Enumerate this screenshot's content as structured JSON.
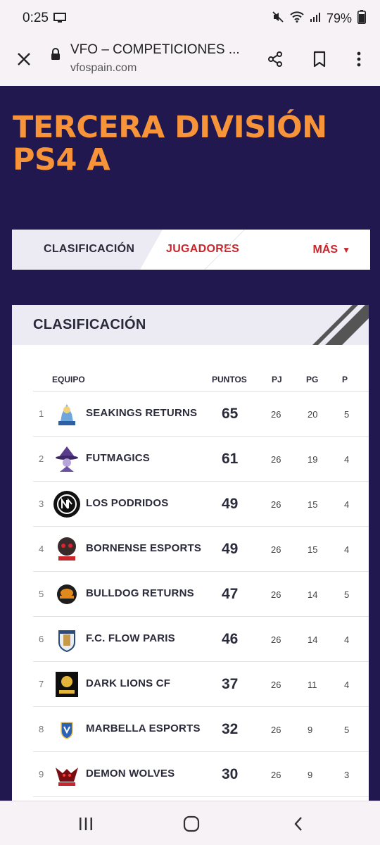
{
  "status": {
    "time": "0:25",
    "battery": "79%"
  },
  "browser": {
    "title": "VFO – COMPETICIONES ...",
    "domain": "vfospain.com"
  },
  "league": {
    "title": "TERCERA DIVISIÓN PS4 A"
  },
  "tabs": {
    "clasificacion": "CLASIFICACIÓN",
    "jugadores": "JUGADORES",
    "mas": "MÁS"
  },
  "card": {
    "title": "CLASIFICACIÓN"
  },
  "table": {
    "headers": {
      "equipo": "EQUIPO",
      "puntos": "PUNTOS",
      "pj": "PJ",
      "pg": "PG",
      "pe": "P"
    },
    "rows": [
      {
        "pos": "1",
        "team": "SEAKINGS RETURNS",
        "pts": "65",
        "pj": "26",
        "pg": "20",
        "pe": "5"
      },
      {
        "pos": "2",
        "team": "FUTMAGICS",
        "pts": "61",
        "pj": "26",
        "pg": "19",
        "pe": "4"
      },
      {
        "pos": "3",
        "team": "LOS PODRIDOS",
        "pts": "49",
        "pj": "26",
        "pg": "15",
        "pe": "4"
      },
      {
        "pos": "4",
        "team": "BORNENSE ESPORTS",
        "pts": "49",
        "pj": "26",
        "pg": "15",
        "pe": "4"
      },
      {
        "pos": "5",
        "team": "BULLDOG RETURNS",
        "pts": "47",
        "pj": "26",
        "pg": "14",
        "pe": "5"
      },
      {
        "pos": "6",
        "team": "F.C. FLOW PARIS",
        "pts": "46",
        "pj": "26",
        "pg": "14",
        "pe": "4"
      },
      {
        "pos": "7",
        "team": "DARK LIONS CF",
        "pts": "37",
        "pj": "26",
        "pg": "11",
        "pe": "4"
      },
      {
        "pos": "8",
        "team": "MARBELLA ESPORTS",
        "pts": "32",
        "pj": "26",
        "pg": "9",
        "pe": "5"
      },
      {
        "pos": "9",
        "team": "DEMON WOLVES",
        "pts": "30",
        "pj": "26",
        "pg": "9",
        "pe": "3"
      }
    ]
  },
  "colors": {
    "background": "#20184f",
    "accent_orange": "#f7943a",
    "accent_red": "#c8262c"
  },
  "icons": [
    "screen-icon",
    "mute-icon",
    "wifi-icon",
    "signal-icon",
    "battery-icon",
    "close-icon",
    "lock-icon",
    "share-icon",
    "bookmark-icon",
    "more-icon",
    "recents-icon",
    "home-icon",
    "back-icon"
  ]
}
